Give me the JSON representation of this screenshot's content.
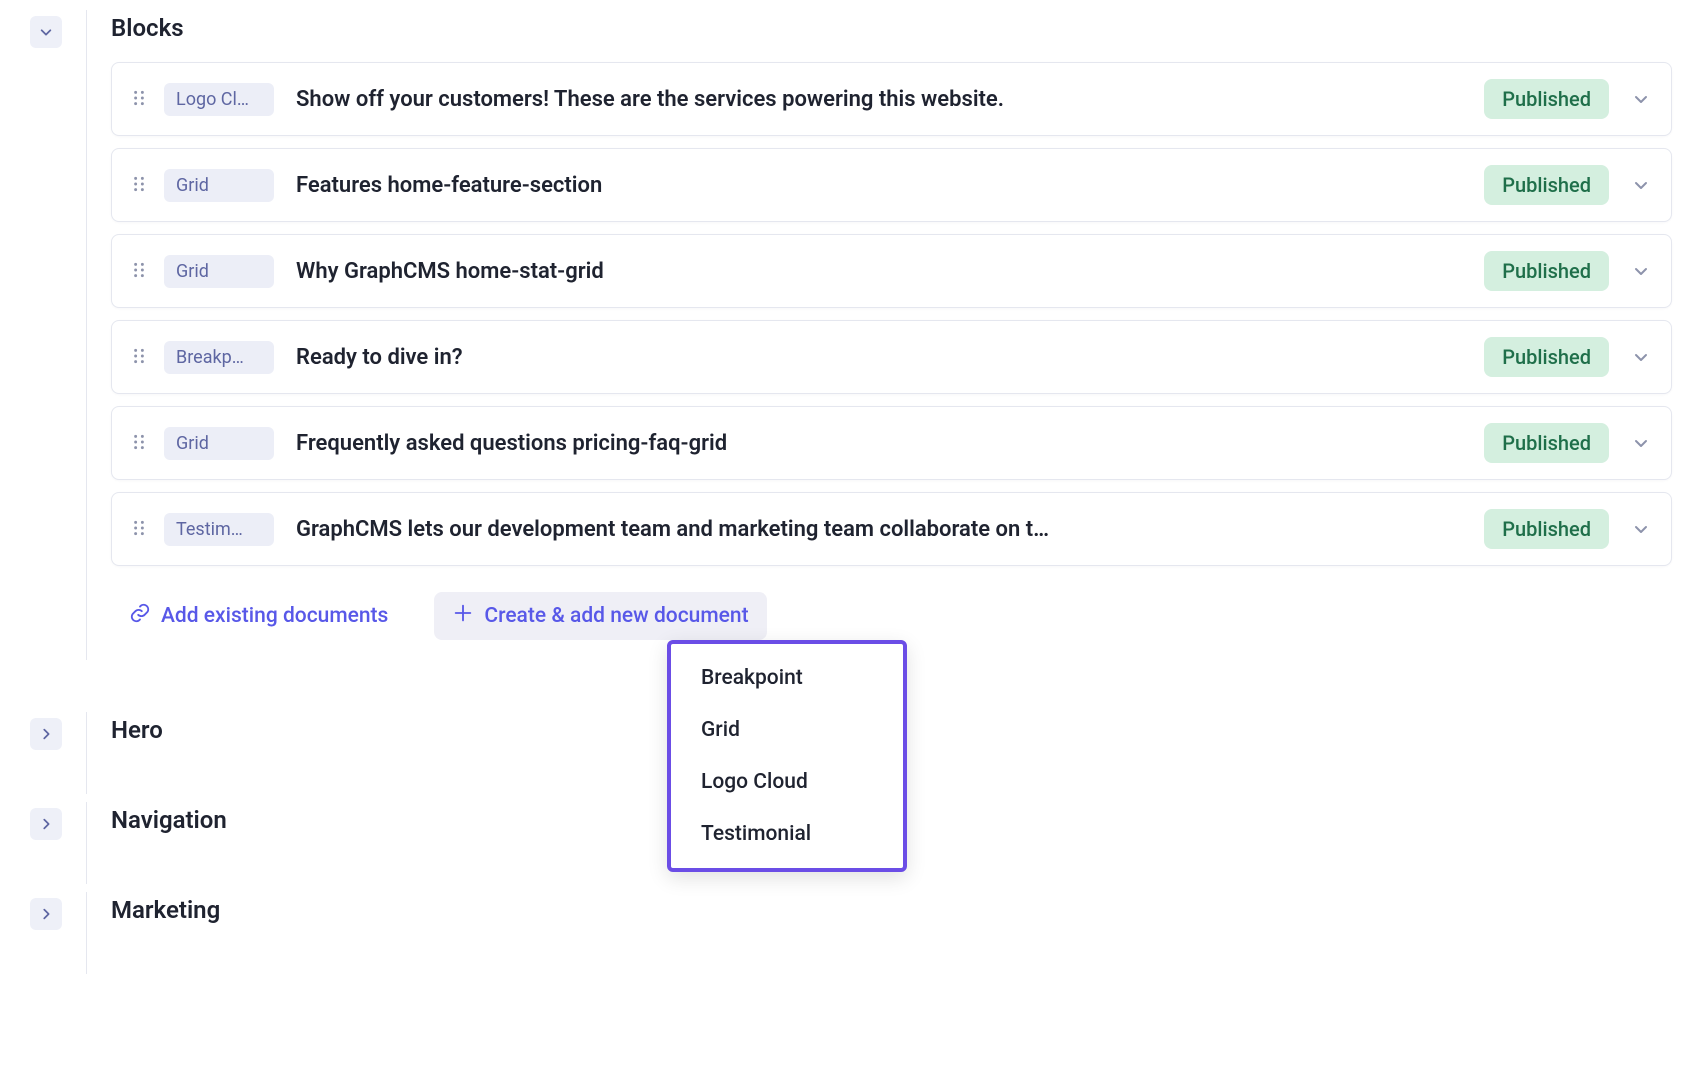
{
  "sections": {
    "blocks": {
      "title": "Blocks",
      "rows": [
        {
          "type": "Logo Cl…",
          "text": "Show off your customers! These are the services powering this website.",
          "status": "Published"
        },
        {
          "type": "Grid",
          "text": "Features home-feature-section",
          "status": "Published"
        },
        {
          "type": "Grid",
          "text": "Why GraphCMS home-stat-grid",
          "status": "Published"
        },
        {
          "type": "Breakp…",
          "text": "Ready to dive in?",
          "status": "Published"
        },
        {
          "type": "Grid",
          "text": "Frequently asked questions pricing-faq-grid",
          "status": "Published"
        },
        {
          "type": "Testim…",
          "text": "GraphCMS lets our development team and marketing team collaborate on t…",
          "status": "Published"
        }
      ],
      "actions": {
        "add_existing": "Add existing documents",
        "create_add": "Create & add new document"
      },
      "dropdown": [
        "Breakpoint",
        "Grid",
        "Logo Cloud",
        "Testimonial"
      ]
    },
    "hero": {
      "title": "Hero"
    },
    "navigation": {
      "title": "Navigation"
    },
    "marketing": {
      "title": "Marketing"
    }
  }
}
